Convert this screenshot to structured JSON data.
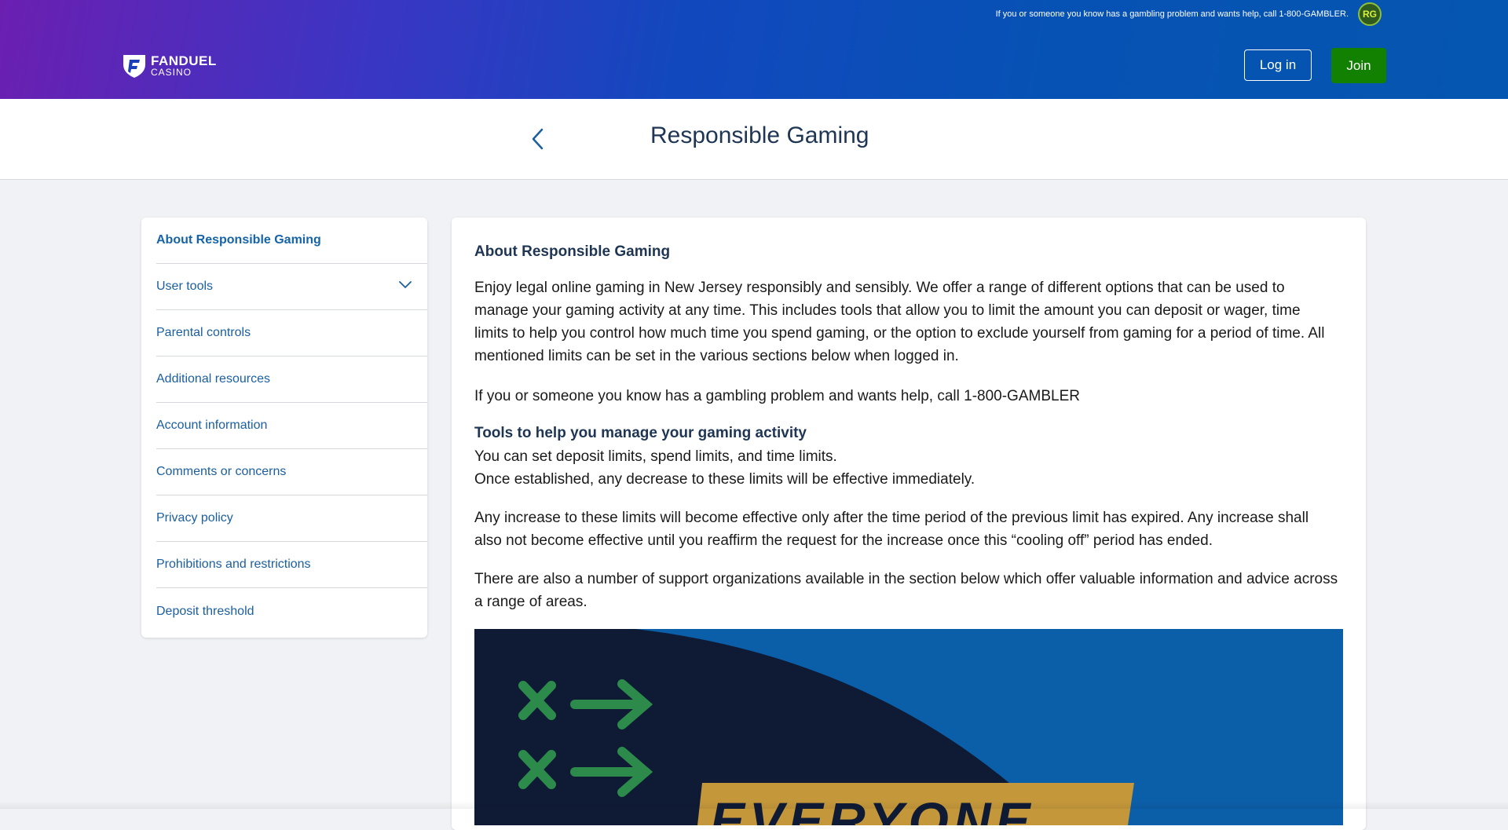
{
  "header": {
    "helpline_text": "If you or someone you know has a gambling problem and wants help, call 1-800-GAMBLER.",
    "rg_badge": "RG",
    "logo": {
      "brand": "FANDUEL",
      "sub": "CASINO",
      "icon": "fanduel-shield-icon"
    },
    "login_label": "Log in",
    "join_label": "Join",
    "colors": {
      "gradient_start": "#6b1fb1",
      "gradient_end": "#0556b0",
      "join": "#128000"
    }
  },
  "titlebar": {
    "back_icon": "chevron-left-icon",
    "title": "Responsible Gaming"
  },
  "sidebar": {
    "items": [
      {
        "label": "About Responsible Gaming",
        "active": true
      },
      {
        "label": "User tools",
        "expandable": true,
        "icon": "chevron-down-icon"
      },
      {
        "label": "Parental controls"
      },
      {
        "label": "Additional resources"
      },
      {
        "label": "Account information"
      },
      {
        "label": "Comments or concerns"
      },
      {
        "label": "Privacy policy"
      },
      {
        "label": "Prohibitions and restrictions"
      },
      {
        "label": "Deposit threshold"
      }
    ]
  },
  "content": {
    "heading": "About Responsible Gaming",
    "intro": "Enjoy legal online gaming in New Jersey responsibly and sensibly. We offer a range of different options that can be used to manage your gaming activity at any time. This includes tools that allow you to limit the amount you can deposit or wager, time limits to help you control how much time you spend gaming, or the option to exclude yourself from gaming for a period of time. All mentioned limits can be set in the various sections below when logged in.",
    "helpline": "If you or someone you know has a gambling problem and wants help, call 1-800-GAMBLER",
    "tools_heading": "Tools to help you manage your gaming activity",
    "tools_line1": "You can set deposit limits, spend limits, and time limits.",
    "tools_line2": "Once established, any decrease to these limits will be effective immediately.",
    "increase": "Any increase to these limits will become effective only after the time period of the previous limit has expired. Any increase shall also not become effective until you reaffirm the request for the increase once this “cooling off” period has ended.",
    "support": "There are also a number of support organizations available in the section below which offer valuable information and advice across a range of areas.",
    "banner_text": "EVERYONE"
  }
}
